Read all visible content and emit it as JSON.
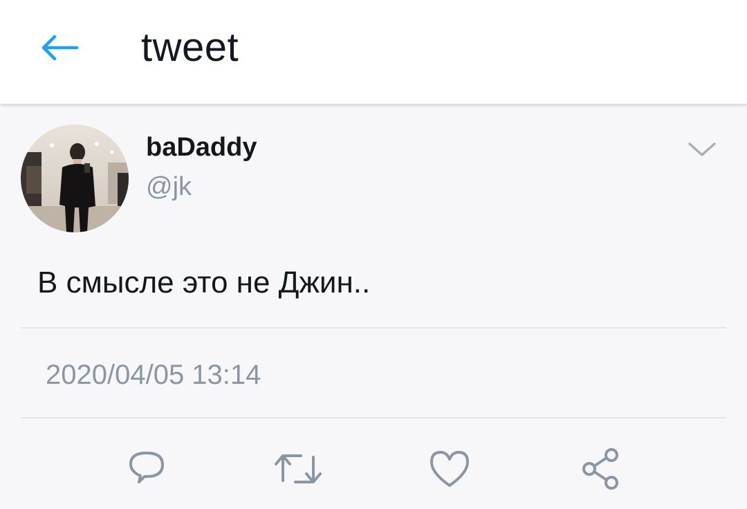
{
  "header": {
    "title": "tweet",
    "back_icon": "arrow-left-icon",
    "accent_color": "#1da1f2"
  },
  "tweet": {
    "display_name": "baDaddy",
    "handle": "@jk",
    "text": "В смысле это не Джин..",
    "timestamp": "2020/04/05 13:14",
    "menu_icon": "chevron-down-icon"
  },
  "actions": [
    {
      "icon": "reply-icon"
    },
    {
      "icon": "retweet-icon"
    },
    {
      "icon": "like-icon"
    },
    {
      "icon": "share-icon"
    }
  ],
  "colors": {
    "text_primary": "#14171a",
    "text_secondary": "#8a96a3",
    "icon_gray": "#8a96a3",
    "background": "#f7f7f9",
    "header_bg": "#ffffff"
  }
}
